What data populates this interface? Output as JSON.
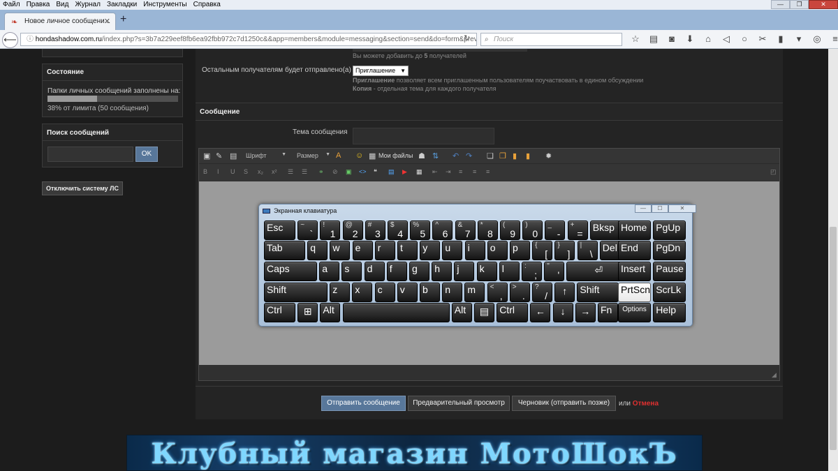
{
  "browser": {
    "menu": [
      "Файл",
      "Правка",
      "Вид",
      "Журнал",
      "Закладки",
      "Инструменты",
      "Справка"
    ],
    "tab_title": "Новое личное сообщени...",
    "url_host": "hondashadow.com.ru",
    "url_path": "/index.php?s=3b7a229eef8fb6ea92fbb972c7d1250c&&app=members&module=messaging&section=send&do=form&previev",
    "search_placeholder": "Поиск",
    "tool_icons": [
      "star-icon",
      "reading-list-icon",
      "pocket-icon",
      "download-icon",
      "home-icon",
      "send-icon",
      "chat-icon",
      "sync-icon",
      "clipboard-icon",
      "menu-overflow-icon",
      "accessibility-icon",
      "hamburger-icon"
    ]
  },
  "sidebar": {
    "state_title": "Состояние",
    "folders_text": "Папки личных сообщений заполнены на:",
    "usage_fraction": 0.38,
    "usage_text": "38% от лимита (50 сообщения)",
    "search_title": "Поиск сообщений",
    "search_value": "",
    "search_button": "OK",
    "disable_button": "Отключить систему ЛС"
  },
  "form": {
    "recipients_note_prefix": "Вы можете добавить до ",
    "recipients_limit": "5",
    "recipients_note_suffix": " получателей",
    "others_label": "Остальным получателям будет отправлено(а)",
    "others_select": "Приглашение",
    "invite_term": "Приглашение",
    "invite_desc": " позволяет всем приглашенным пользователям поучаствовать в едином обсуждении",
    "copy_term": "Копия",
    "copy_desc": " - отдельная тема для каждого получателя",
    "message_section": "Сообщение",
    "subject_label": "Тема сообщения",
    "subject_value": ""
  },
  "editor": {
    "font_label": "Шрифт",
    "size_label": "Размер",
    "my_files": "Мои файлы"
  },
  "osk": {
    "title": "Экранная клавиатура",
    "rows": [
      [
        {
          "l": "Esc"
        },
        {
          "s": "~",
          "b": "`"
        },
        {
          "s": "!",
          "b": "1"
        },
        {
          "s": "@",
          "b": "2"
        },
        {
          "s": "#",
          "b": "3"
        },
        {
          "s": "$",
          "b": "4"
        },
        {
          "s": "%",
          "b": "5"
        },
        {
          "s": "^",
          "b": "6"
        },
        {
          "s": "&",
          "b": "7"
        },
        {
          "s": "*",
          "b": "8"
        },
        {
          "s": "(",
          "b": "9"
        },
        {
          "s": ")",
          "b": "0"
        },
        {
          "s": "_",
          "b": "-"
        },
        {
          "s": "+",
          "b": "="
        },
        {
          "l": "Bksp"
        },
        {
          "l": "Home"
        },
        {
          "l": "PgUp"
        }
      ],
      [
        {
          "l": "Tab"
        },
        {
          "l": "q"
        },
        {
          "l": "w"
        },
        {
          "l": "e"
        },
        {
          "l": "r"
        },
        {
          "l": "t"
        },
        {
          "l": "y"
        },
        {
          "l": "u"
        },
        {
          "l": "i"
        },
        {
          "l": "o"
        },
        {
          "l": "p"
        },
        {
          "s": "{",
          "b": "["
        },
        {
          "s": "}",
          "b": "]"
        },
        {
          "s": "|",
          "b": "\\"
        },
        {
          "l": "Del"
        },
        {
          "l": "End"
        },
        {
          "l": "PgDn"
        }
      ],
      [
        {
          "l": "Caps"
        },
        {
          "l": "a"
        },
        {
          "l": "s"
        },
        {
          "l": "d"
        },
        {
          "l": "f"
        },
        {
          "l": "g"
        },
        {
          "l": "h"
        },
        {
          "l": "j"
        },
        {
          "l": "k"
        },
        {
          "l": "l"
        },
        {
          "s": ":",
          "b": ";"
        },
        {
          "s": "\"",
          "b": "'"
        },
        {
          "l": "⏎"
        },
        {
          "l": "Insert"
        },
        {
          "l": "Pause"
        }
      ],
      [
        {
          "l": "Shift"
        },
        {
          "l": "z"
        },
        {
          "l": "x"
        },
        {
          "l": "c"
        },
        {
          "l": "v"
        },
        {
          "l": "b"
        },
        {
          "l": "n"
        },
        {
          "l": "m"
        },
        {
          "s": "<",
          "b": ","
        },
        {
          "s": ">",
          "b": "."
        },
        {
          "s": "?",
          "b": "/"
        },
        {
          "l": "↑"
        },
        {
          "l": "Shift"
        },
        {
          "l": "PrtScn"
        },
        {
          "l": "ScrLk"
        }
      ],
      [
        {
          "l": "Ctrl"
        },
        {
          "l": "⊞"
        },
        {
          "l": "Alt"
        },
        {
          "l": ""
        },
        {
          "l": "Alt"
        },
        {
          "l": "▤"
        },
        {
          "l": "Ctrl"
        },
        {
          "l": "←"
        },
        {
          "l": "↓"
        },
        {
          "l": "→"
        },
        {
          "l": "Fn"
        },
        {
          "l": "Options"
        },
        {
          "l": "Help"
        }
      ]
    ]
  },
  "footer": {
    "send": "Отправить сообщение",
    "preview": "Предварительный просмотр",
    "draft": "Черновик (отправить позже)",
    "or": "или ",
    "cancel": "Отмена",
    "banner": "Клубный магазин МотоШокЪ"
  }
}
